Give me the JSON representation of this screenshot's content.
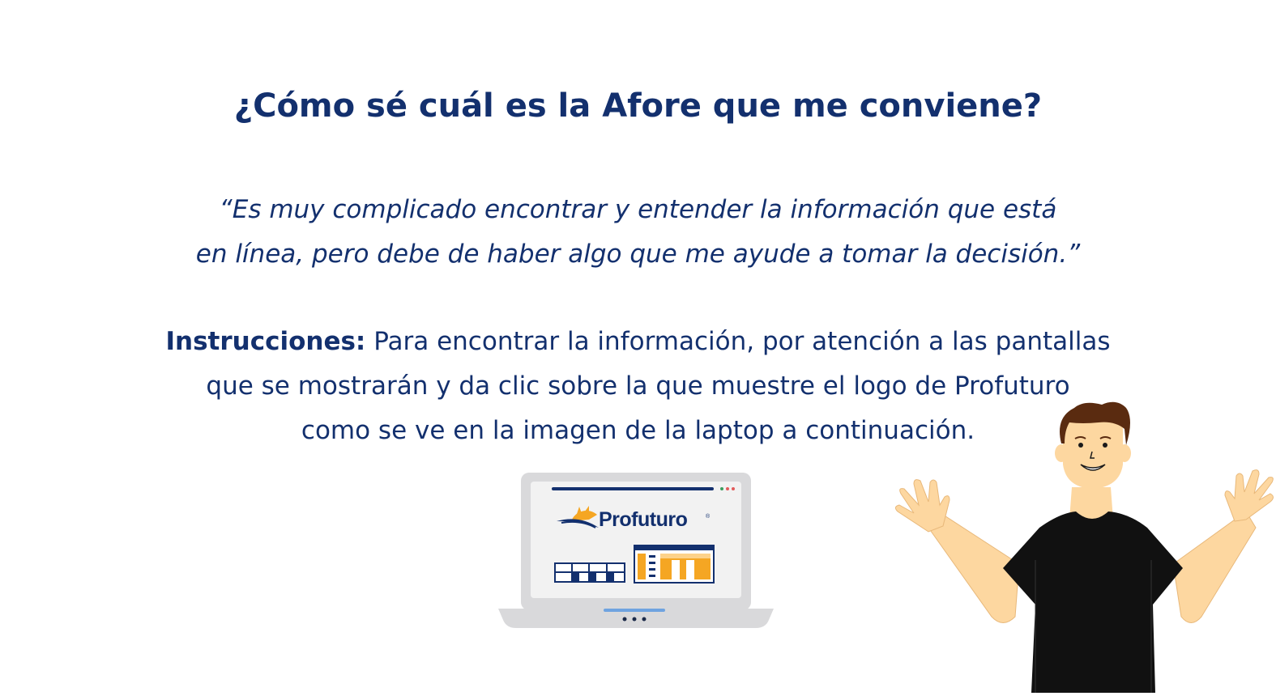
{
  "heading": "¿Cómo sé cuál es la Afore que me conviene?",
  "quote": {
    "line1": "“Es muy complicado encontrar y entender la información que está",
    "line2": "en línea, pero debe de haber algo que me ayude a tomar la decisión.”"
  },
  "instructions": {
    "label": "Instrucciones:",
    "line1": " Para encontrar la información, por atención a las pantallas",
    "line2": "que se mostrarán y da clic sobre la que muestre el logo de Profuturo",
    "line3": "como se ve en la imagen de la laptop a continuación."
  },
  "laptop": {
    "brand": "Profuturo",
    "registered_mark": "®"
  },
  "colors": {
    "navy": "#13306e",
    "orange": "#f5a623",
    "skin": "#fdd7a0",
    "hair": "#5a2b10",
    "shirt": "#111111",
    "laptop_gray": "#d9d9db"
  },
  "icons": [
    "laptop-illustration",
    "profuturo-logo-icon",
    "person-illustration"
  ]
}
